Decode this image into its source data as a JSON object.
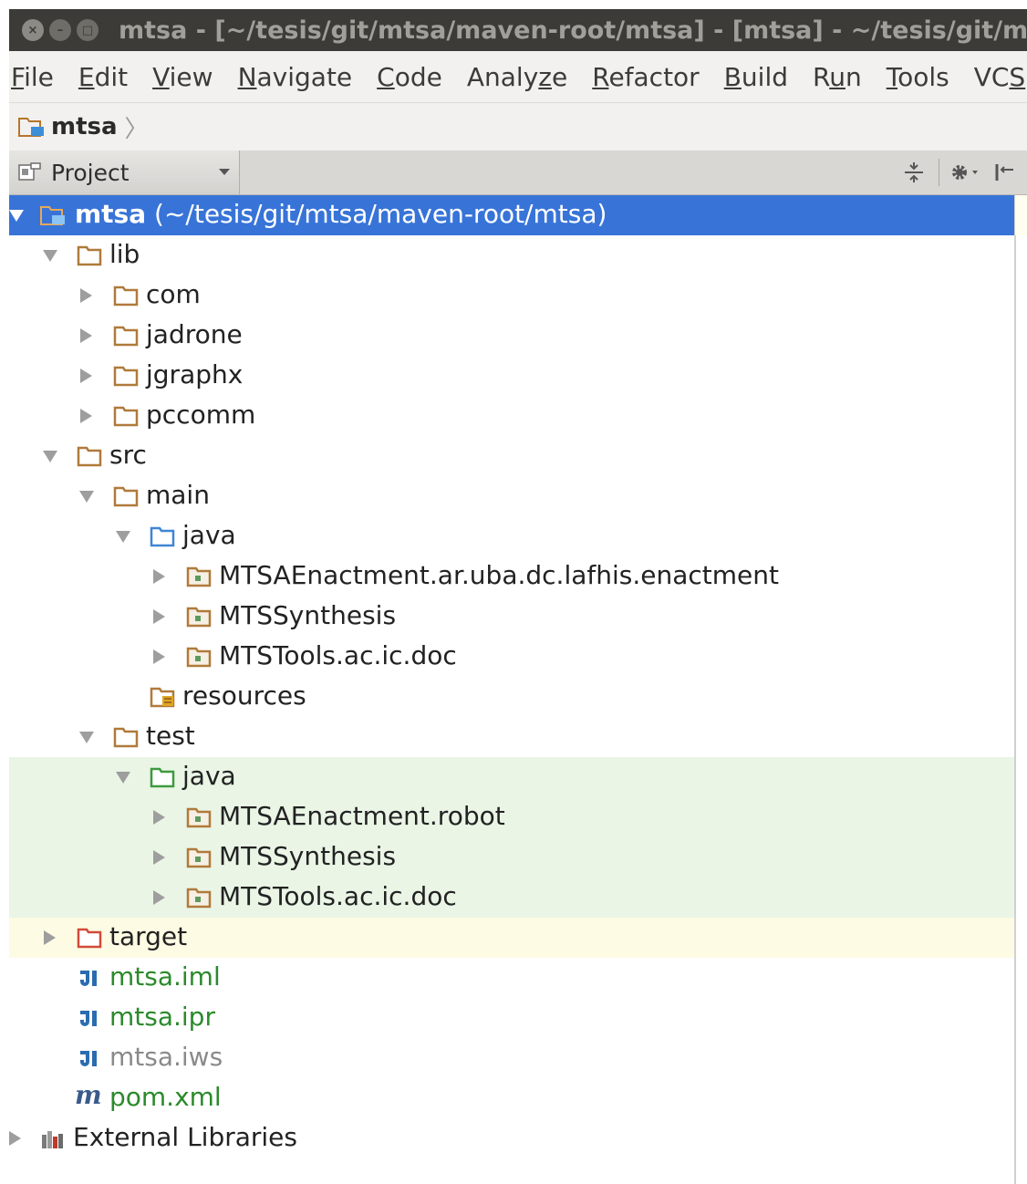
{
  "window": {
    "title": "mtsa - [~/tesis/git/mtsa/maven-root/mtsa] - [mtsa] - ~/tesis/git/mtsa/maven-root/mtsa"
  },
  "menu": [
    {
      "mnemonic": "F",
      "rest": "ile"
    },
    {
      "mnemonic": "E",
      "rest": "dit"
    },
    {
      "mnemonic": "V",
      "rest": "iew"
    },
    {
      "mnemonic": "N",
      "rest": "avigate"
    },
    {
      "mnemonic": "C",
      "rest": "ode"
    },
    {
      "pre": "Analy",
      "mnemonic": "z",
      "rest": "e"
    },
    {
      "mnemonic": "R",
      "rest": "efactor"
    },
    {
      "mnemonic": "B",
      "rest": "uild"
    },
    {
      "pre": "R",
      "mnemonic": "u",
      "rest": "n"
    },
    {
      "mnemonic": "T",
      "rest": "ools"
    },
    {
      "pre": "VC",
      "mnemonic": "S",
      "rest": ""
    }
  ],
  "navbar": {
    "crumb": "mtsa",
    "separator": "〉"
  },
  "toolwindow": {
    "view": "Project"
  },
  "colors": {
    "selection": "#3874d8",
    "test_bg": "#eaf5e6",
    "excluded_bg": "#fdfbe3",
    "vcs_green": "#2b8a2b"
  },
  "tree": {
    "root": {
      "name": "mtsa",
      "path": "(~/tesis/git/mtsa/maven-root/mtsa)"
    },
    "lib": "lib",
    "lib_children": [
      "com",
      "jadrone",
      "jgraphx",
      "pccomm"
    ],
    "src": "src",
    "main": "main",
    "main_java": "java",
    "main_packages": [
      "MTSAEnactment.ar.uba.dc.lafhis.enactment",
      "MTSSynthesis",
      "MTSTools.ac.ic.doc"
    ],
    "resources": "resources",
    "test": "test",
    "test_java": "java",
    "test_packages": [
      "MTSAEnactment.robot",
      "MTSSynthesis",
      "MTSTools.ac.ic.doc"
    ],
    "target": "target",
    "files": [
      "mtsa.iml",
      "mtsa.ipr",
      "mtsa.iws",
      "pom.xml"
    ],
    "maven_letter": "m",
    "external": "External Libraries"
  }
}
